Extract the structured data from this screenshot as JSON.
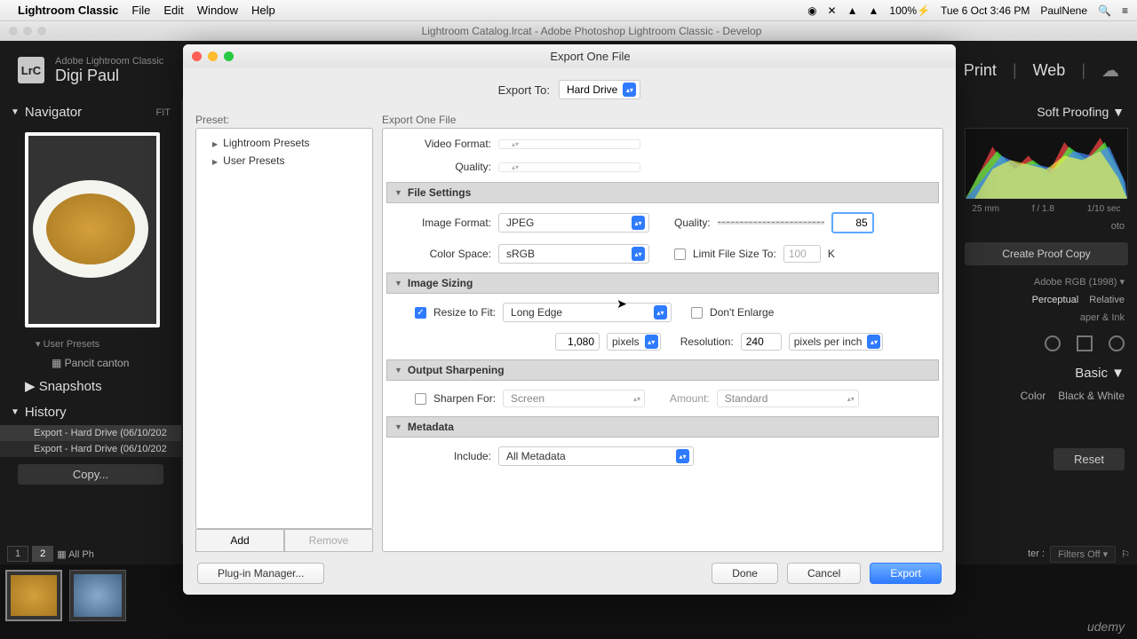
{
  "menubar": {
    "app": "Lightroom Classic",
    "items": [
      "File",
      "Edit",
      "Window",
      "Help"
    ],
    "battery": "100%",
    "datetime": "Tue 6 Oct  3:46 PM",
    "username": "PaulNene"
  },
  "window_title": "Lightroom Catalog.lrcat - Adobe Photoshop Lightroom Classic - Develop",
  "lr_top": {
    "logo": "LrC",
    "brand": "Adobe Lightroom Classic",
    "user": "Digi Paul",
    "modules": [
      "Print",
      "Web"
    ]
  },
  "left": {
    "navigator": "Navigator",
    "fit": "FIT",
    "user_presets_label": "User Presets",
    "pancit": "Pancit canton",
    "snapshots": "Snapshots",
    "history": "History",
    "history_items": [
      "Export - Hard Drive (06/10/202",
      "Export - Hard Drive (06/10/202"
    ],
    "copy": "Copy..."
  },
  "right": {
    "soft_proofing": "Soft Proofing",
    "histo": {
      "focal": "25 mm",
      "aperture": "f / 1.8",
      "shutter": "1/10 sec"
    },
    "oto": "oto",
    "create_proof": "Create Proof Copy",
    "profile": "Adobe RGB (1998)",
    "intent_perceptual": "Perceptual",
    "intent_relative": "Relative",
    "paper_ink": "aper & Ink",
    "basic": "Basic",
    "color": "Color",
    "bw": "Black & White",
    "reset": "Reset"
  },
  "filmstrip": {
    "pages": [
      "1",
      "2"
    ],
    "all": "All Ph",
    "filter_label": "ter :",
    "filter_value": "Filters Off"
  },
  "dialog": {
    "title": "Export One File",
    "export_to_label": "Export To:",
    "export_to_value": "Hard Drive",
    "preset_label": "Preset:",
    "presets": [
      "Lightroom Presets",
      "User Presets"
    ],
    "add": "Add",
    "remove": "Remove",
    "settings_label": "Export One File",
    "video_format_label": "Video Format:",
    "quality_label": "Quality:",
    "file_settings": "File Settings",
    "image_format_label": "Image Format:",
    "image_format_value": "JPEG",
    "quality2_label": "Quality:",
    "quality2_value": "85",
    "color_space_label": "Color Space:",
    "color_space_value": "sRGB",
    "limit_label": "Limit File Size To:",
    "limit_value": "100",
    "limit_unit": "K",
    "image_sizing": "Image Sizing",
    "resize_label": "Resize to Fit:",
    "resize_value": "Long Edge",
    "dont_enlarge": "Don't Enlarge",
    "dim_value": "1,080",
    "dim_unit": "pixels",
    "resolution_label": "Resolution:",
    "resolution_value": "240",
    "resolution_unit": "pixels per inch",
    "output_sharpening": "Output Sharpening",
    "sharpen_label": "Sharpen For:",
    "sharpen_value": "Screen",
    "amount_label": "Amount:",
    "amount_value": "Standard",
    "metadata": "Metadata",
    "include_label": "Include:",
    "include_value": "All Metadata",
    "plugin_manager": "Plug-in Manager...",
    "done": "Done",
    "cancel": "Cancel",
    "export": "Export"
  },
  "udemy": "udemy"
}
